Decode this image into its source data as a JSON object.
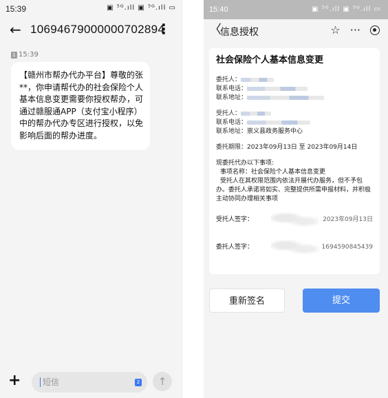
{
  "left_phone": {
    "status_bar": {
      "time": "15:39",
      "icons": "▣ ⁵ᴳ.ıll ▣ ⁵ᴳ.ıll ▭"
    },
    "header": {
      "back_icon": "←",
      "title": "10694679000000702894",
      "more_icon": "⋮"
    },
    "message": {
      "time": "15:39",
      "sim_badge": "1",
      "text": "【赣州市帮办代办平台】尊敬的张**，你申请帮代办的社会保险个人基本信息变更需要你授权帮办，可通过赣服通APP（支付宝小程序）中的帮办代办专区进行授权，以免影响后面的帮办进度。"
    },
    "input_bar": {
      "plus_icon": "+",
      "placeholder": "短信",
      "sim_badge": "2",
      "send_icon": "↑"
    }
  },
  "right_phone": {
    "status_bar": {
      "time": "15:40",
      "icons": "▣ ⁵ᴳ.ıll ▣ ⁵ᴳ.ıll ▭"
    },
    "header": {
      "back_icon": "〈",
      "title": "信息授权",
      "star_icon": "☆",
      "more_icon": "···"
    },
    "card": {
      "title": "社会保险个人基本信息变更",
      "principal_label": "委托人：",
      "phone_label": "联系电话：",
      "address_label": "联系地址：",
      "agent_label": "受托人：",
      "agent_phone_label": "联系电话：",
      "agent_address_label": "联系地址：",
      "agent_address": "崇义县政务服务中心",
      "period_label": "委托期限：",
      "period_value": "2023年09月13日  至  2023年09月14日",
      "matters_heading": "现委托代办以下事项:",
      "matter_name": "事项名称：社会保险个人基本信息变更",
      "matter_desc": "受托人在其权限范围内依法开展代办服务，但不予包办。委托人承诺将如实、完整提供所需申报材料，并积极主动协同办理相关事项",
      "agent_sign_label": "受托人签字：",
      "agent_sign_value": "2023年09月13日",
      "principal_sign_label": "委托人签字：",
      "principal_sign_value": "1694590845439"
    },
    "buttons": {
      "resign": "重新签名",
      "submit": "提交"
    }
  }
}
